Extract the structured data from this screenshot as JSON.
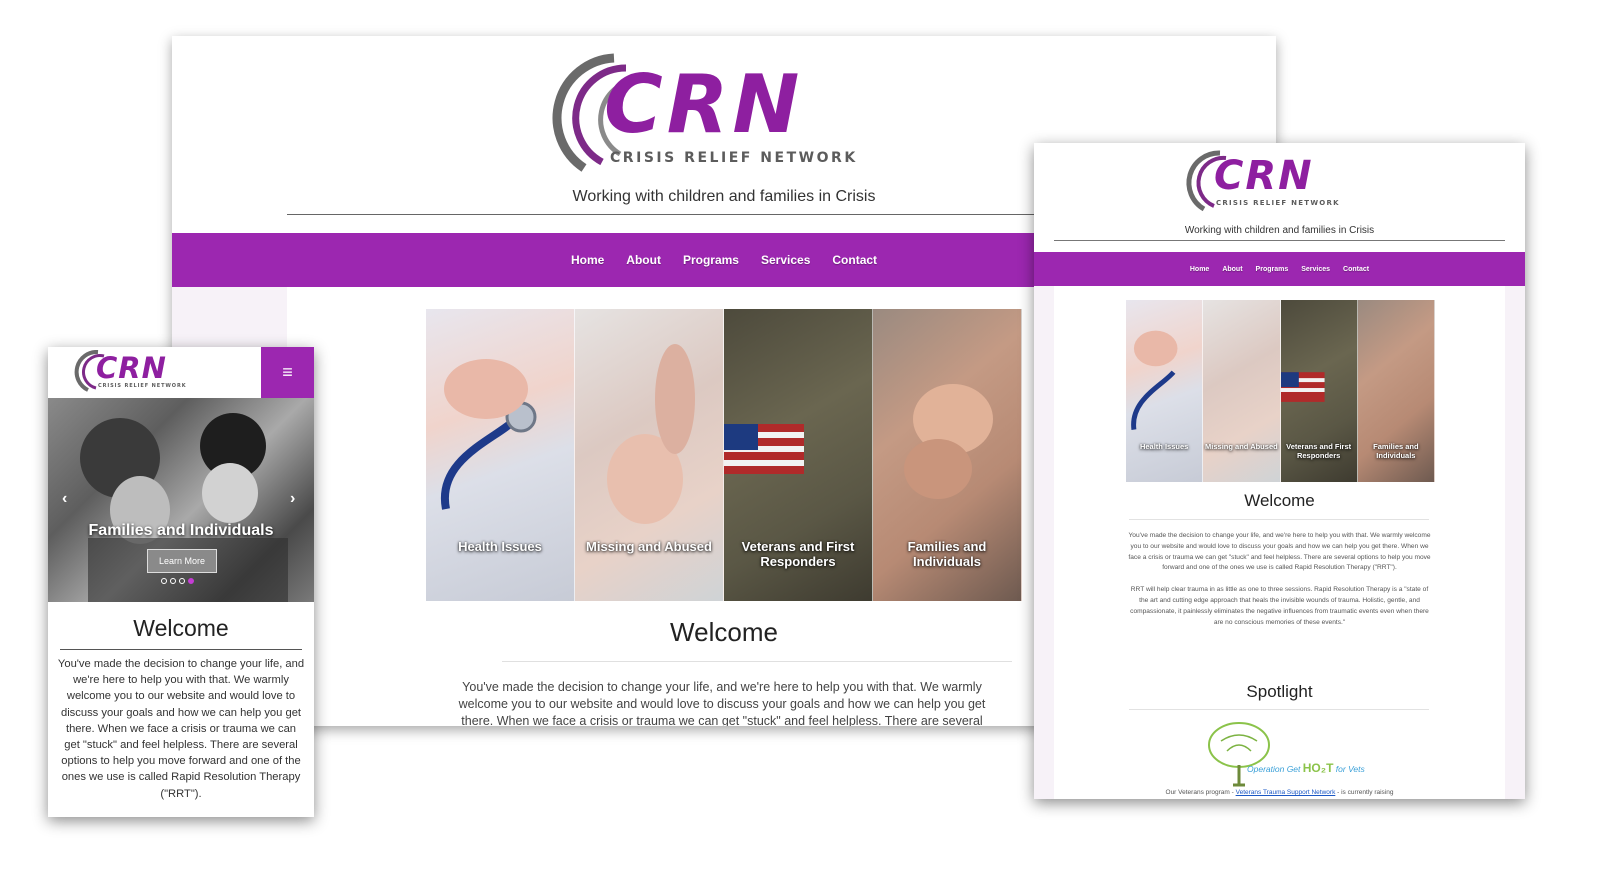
{
  "brand": {
    "logo_text": "CRN",
    "logo_subtitle": "CRISIS RELIEF NETWORK",
    "tagline": "Working with children and families in Crisis",
    "accent_color": "#9c27b0"
  },
  "nav": {
    "items": [
      {
        "label": "Home"
      },
      {
        "label": "About"
      },
      {
        "label": "Programs"
      },
      {
        "label": "Services"
      },
      {
        "label": "Contact"
      }
    ]
  },
  "panels": [
    {
      "label": "Health Issues"
    },
    {
      "label": "Missing and Abused"
    },
    {
      "label": "Veterans and First Responders"
    },
    {
      "label": "Families and Individuals"
    }
  ],
  "welcome": {
    "title": "Welcome",
    "desktop_text": "You've made the decision to change your life, and we're here to help you with that. We warmly welcome you to our website and would love to discuss your goals and how we can help you get there. When we face a crisis or trauma we can get \"stuck\" and feel helpless. There are several",
    "paragraph_1": "You've made the decision to change your life, and we're here to help you with that. We warmly welcome you to our website and would love to discuss your goals and how we can help you get there. When we face a crisis or trauma we can get \"stuck\" and feel helpless. There are several options to help you move forward and one of the ones we use is called Rapid Resolution Therapy (\"RRT\").",
    "paragraph_2": "RRT will help clear trauma in as little as one to three sessions. Rapid Resolution Therapy is a \"state of the art and cutting edge approach that heals the invisible wounds of trauma. Holistic, gentle, and compassionate, it painlessly eliminates the negative influences from traumatic events even when there are no conscious memories of these events.\""
  },
  "spotlight": {
    "title": "Spotlight",
    "image_caption_prefix": "Operation Get ",
    "image_caption_big": "HO₂T",
    "image_caption_suffix": " for Vets",
    "text_before": "Our Veterans program - ",
    "link": "Veterans Trauma Support Network",
    "text_after": " - is currently raising"
  },
  "mobile": {
    "menu_icon": "≡",
    "slide_title": "Families and Individuals",
    "learn_more": "Learn More",
    "prev_arrow": "‹",
    "next_arrow": "›",
    "slide_count": 4,
    "active_slide": 4
  }
}
